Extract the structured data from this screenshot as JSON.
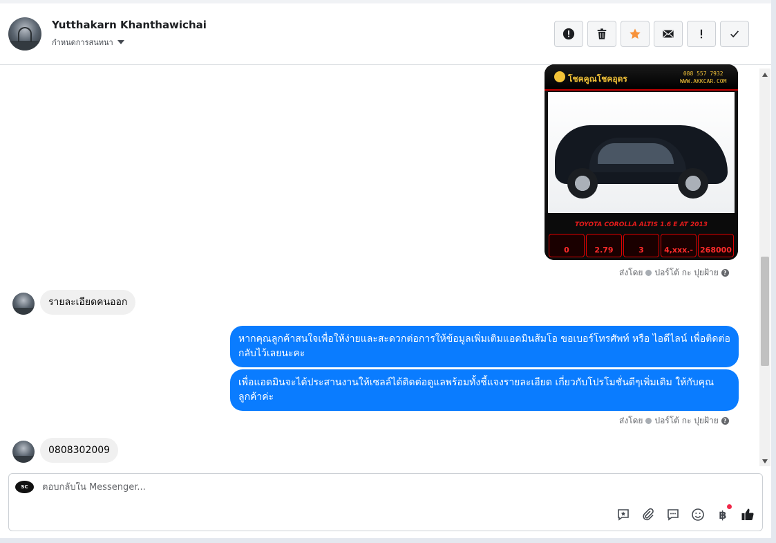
{
  "header": {
    "contact_name": "Yutthakarn Khanthawichai",
    "assign_label": "กำหนดการสนทนา"
  },
  "actions": {
    "spam": "exclamation-circle-icon",
    "delete": "trash-icon",
    "star": "star-icon",
    "mark_unread": "envelope-icon",
    "follow_up": "exclamation-icon",
    "done": "checkmark-icon",
    "star_color": "#f7923a"
  },
  "car_ad": {
    "logo_text": "โชคคูณโชคอุดร",
    "phone": "088 557 7932",
    "website": "WWW.AKKCAR.COM",
    "model": "TOYOTA COROLLA ALTIS 1.6 E AT 2013",
    "specs": [
      "0",
      "2.79",
      "3",
      "4,xxx.-",
      "268000"
    ]
  },
  "messages": {
    "sent_by_1": "ส่งโดย",
    "sender_1": "ปอร์โต้ กะ ปุยฝ้าย",
    "incoming_1": "รายละเอียดคนออก",
    "outgoing_1": "หากคุณลูกค้าสนใจเพื่อให้ง่ายและสะดวกต่อการให้ข้อมูลเพิ่มเติมแอดมินส้มโอ ขอเบอร์โทรศัพท์ หรือ ไอดีไลน์ เพื่อติดต่อกลับไว้เลยนะคะ",
    "outgoing_2": "เพื่อแอดมินจะได้ประสานงานให้เซลล์ได้ติดต่อดูแลพร้อมทั้งชี้แจงรายละเอียด เกี่ยวกับโปรโมชั่นดีๆเพิ่มเติม ให้กับคุณลูกค้าค่ะ",
    "sent_by_2": "ส่งโดย",
    "sender_2": "ปอร์โต้ กะ ปุยฝ้าย",
    "incoming_2": "0808302009"
  },
  "composer": {
    "placeholder": "ตอบกลับใน Messenger...",
    "page_avatar_text": "SC",
    "currency_symbol": "฿",
    "accent": "#0a7cff"
  }
}
